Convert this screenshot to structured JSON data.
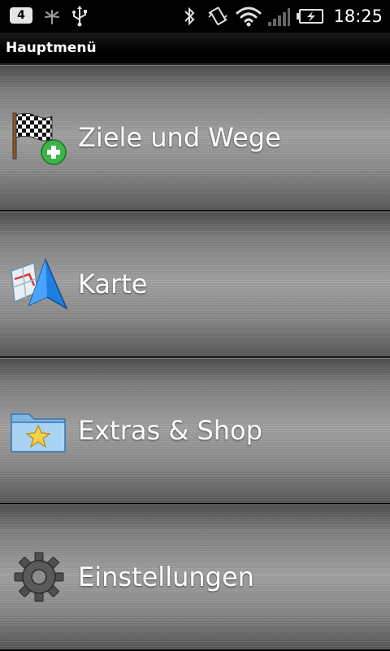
{
  "status_bar": {
    "notification_count": "4",
    "icons": [
      "sync-icon",
      "usb-icon",
      "bluetooth-icon",
      "vibrate-icon",
      "wifi-icon",
      "signal-icon",
      "battery-charging-icon"
    ],
    "time": "18:25"
  },
  "title_bar": {
    "title": "Hauptmenü"
  },
  "menu": {
    "items": [
      {
        "label": "Ziele und Wege",
        "icon": "checkered-flag-add-icon"
      },
      {
        "label": "Karte",
        "icon": "map-arrow-icon"
      },
      {
        "label": "Extras & Shop",
        "icon": "folder-star-icon"
      },
      {
        "label": "Einstellungen",
        "icon": "gear-icon"
      }
    ]
  },
  "colors": {
    "status_bar_bg": "#000000",
    "title_bar_bg": "#000000",
    "menu_item_bg": "#8c8c8c",
    "text": "#ffffff",
    "add_badge_green": "#3db54a",
    "map_arrow_blue": "#1f7fe0"
  }
}
